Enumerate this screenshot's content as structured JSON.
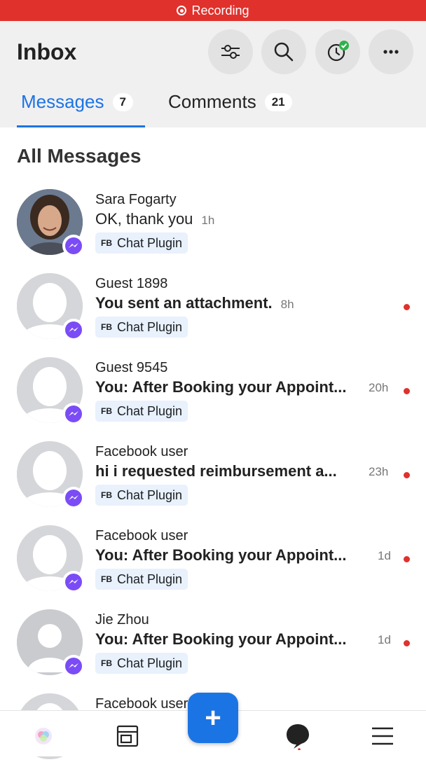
{
  "recording": {
    "label": "Recording"
  },
  "header": {
    "title": "Inbox",
    "tabs": [
      {
        "label": "Messages",
        "count": "7",
        "active": true
      },
      {
        "label": "Comments",
        "count": "21",
        "active": false
      }
    ],
    "icons": [
      "filter-icon",
      "search-icon",
      "activity-check-icon",
      "more-icon"
    ]
  },
  "section": {
    "title": "All Messages"
  },
  "messages": [
    {
      "name": "Sara Fogarty",
      "preview": "OK, thank you",
      "time": "1h",
      "tag_prefix": "FB",
      "tag": "Chat Plugin",
      "unread": false
    },
    {
      "name": "Guest 1898",
      "preview": "You sent an attachment.",
      "time": "8h",
      "tag_prefix": "FB",
      "tag": "Chat Plugin",
      "unread": true
    },
    {
      "name": "Guest 9545",
      "preview": "You: After Booking your Appoint...",
      "time": "20h",
      "tag_prefix": "FB",
      "tag": "Chat Plugin",
      "unread": true
    },
    {
      "name": "Facebook user",
      "preview": "hi i requested reimbursement a...",
      "time": "23h",
      "tag_prefix": "FB",
      "tag": "Chat Plugin",
      "unread": true
    },
    {
      "name": "Facebook user",
      "preview": "You: After Booking your Appoint...",
      "time": "1d",
      "tag_prefix": "FB",
      "tag": "Chat Plugin",
      "unread": true
    },
    {
      "name": "Jie Zhou",
      "preview": "You: After Booking your Appoint...",
      "time": "1d",
      "tag_prefix": "FB",
      "tag": "Chat Plugin",
      "unread": true
    },
    {
      "name": "Facebook user",
      "preview": "",
      "time": "",
      "tag_prefix": "",
      "tag": "",
      "unread": false
    }
  ],
  "fab": {
    "label": "+"
  },
  "colors": {
    "accent": "#1b74e4",
    "recording": "#e0312c",
    "unread_dot": "#e0312c",
    "tag_bg": "#e8f1fc"
  }
}
